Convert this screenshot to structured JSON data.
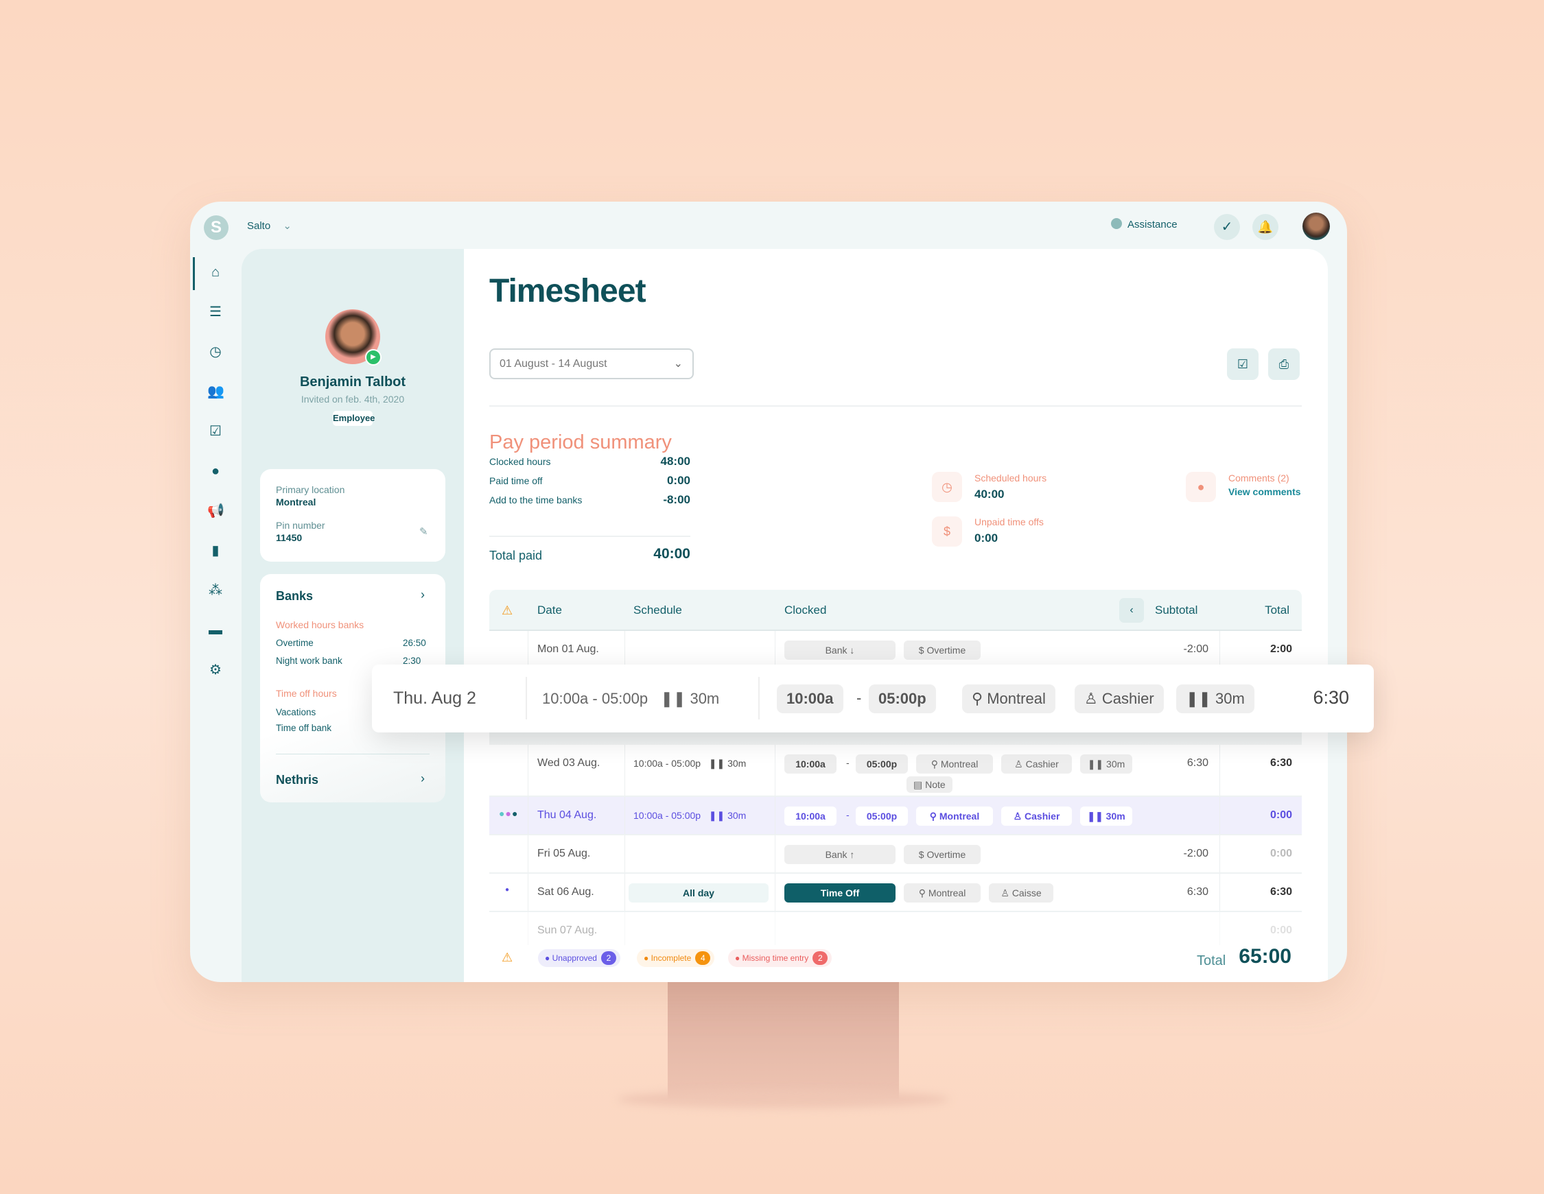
{
  "colors": {
    "brand": "#14606a",
    "accent": "#f0917a",
    "highlight": "#5b4ee0",
    "background": "#fcd8c2"
  },
  "topbar": {
    "logo_letter": "S",
    "org": "Salto",
    "assistance": "Assistance"
  },
  "rail": [
    {
      "icon": "home-icon",
      "glyph": "⌂"
    },
    {
      "icon": "list-icon",
      "glyph": "☰"
    },
    {
      "icon": "clock-icon",
      "glyph": "◷"
    },
    {
      "icon": "users-icon",
      "glyph": "👥"
    },
    {
      "icon": "tasks-icon",
      "glyph": "☑"
    },
    {
      "icon": "chat-icon",
      "glyph": "●"
    },
    {
      "icon": "megaphone-icon",
      "glyph": "📢"
    },
    {
      "icon": "chart-icon",
      "glyph": "▮"
    },
    {
      "icon": "org-icon",
      "glyph": "⁂"
    },
    {
      "icon": "card-icon",
      "glyph": "▬"
    },
    {
      "icon": "settings-icon",
      "glyph": "⚙"
    }
  ],
  "profile": {
    "name": "Benjamin Talbot",
    "invited": "Invited on feb. 4th, 2020",
    "role": "Employee",
    "location_label": "Primary location",
    "location": "Montreal",
    "pin_label": "Pin number",
    "pin": "11450"
  },
  "banks": {
    "title": "Banks",
    "worked_title": "Worked hours banks",
    "worked": [
      {
        "label": "Overtime",
        "value": "26:50"
      },
      {
        "label": "Night work bank",
        "value": "2:30"
      }
    ],
    "timeoff_title": "Time off hours",
    "timeoff": [
      {
        "label": "Vacations"
      },
      {
        "label": "Time off bank"
      }
    ],
    "nethris": "Nethris"
  },
  "main": {
    "title": "Timesheet",
    "period": "01 August - 14 August"
  },
  "summary": {
    "title": "Pay period summary",
    "rows": [
      {
        "label": "Clocked hours",
        "value": "48:00"
      },
      {
        "label": "Paid time off",
        "value": "0:00"
      },
      {
        "label": "Add to the time banks",
        "value": "-8:00"
      }
    ],
    "total_label": "Total paid",
    "total": "40:00",
    "scheduled_label": "Scheduled hours",
    "scheduled": "40:00",
    "unpaid_label": "Unpaid time offs",
    "unpaid": "0:00",
    "comments_label": "Comments (2)",
    "comments_link": "View comments"
  },
  "table": {
    "headers": {
      "date": "Date",
      "schedule": "Schedule",
      "clocked": "Clocked",
      "subtotal": "Subtotal",
      "total": "Total"
    },
    "rows": [
      {
        "date": "Mon 01 Aug.",
        "schedule": "",
        "chips": [
          "Bank ↓",
          "$ Overtime"
        ],
        "subtotal": "-2:00",
        "total": "2:00"
      },
      {
        "date": "Wed 03 Aug.",
        "schedule": "10:00a - 05:00p   ❚❚ 30m",
        "chips": [
          "10:00a",
          "-",
          "05:00p",
          "⚲ Montreal",
          "♙ Cashier",
          "❚❚ 30m"
        ],
        "extra": "▤ Note",
        "subtotal": "6:30",
        "total": "6:30"
      },
      {
        "date": "Thu 04 Aug.",
        "schedule": "10:00a - 05:00p   ❚❚ 30m",
        "chips": [
          "10:00a",
          "-",
          "05:00p",
          "⚲ Montreal",
          "♙ Cashier",
          "❚❚ 30m"
        ],
        "subtotal": "",
        "total": "0:00",
        "highlight": true
      },
      {
        "date": "Fri 05 Aug.",
        "schedule": "",
        "chips": [
          "Bank ↑",
          "$ Overtime"
        ],
        "subtotal": "-2:00",
        "total": "0:00"
      },
      {
        "date": "Sat 06 Aug.",
        "schedule": "All day",
        "chips": [
          "Time Off",
          "⚲ Montreal",
          "♙ Caisse"
        ],
        "subtotal": "6:30",
        "total": "6:30"
      },
      {
        "date": "Sun 07 Aug.",
        "schedule": "",
        "chips": [],
        "subtotal": "",
        "total": "0:00"
      }
    ],
    "footer": {
      "unapproved": "Unapproved",
      "unapproved_n": "2",
      "incomplete": "Incomplete",
      "incomplete_n": "4",
      "missing": "Missing time entry",
      "missing_n": "2",
      "total_label": "Total",
      "total": "65:00"
    }
  },
  "float_row": {
    "date": "Thu. Aug 2",
    "schedule": "10:00a - 05:00p",
    "break": "❚❚ 30m",
    "start": "10:00a",
    "sep": "-",
    "end": "05:00p",
    "location": "Montreal",
    "position": "Cashier",
    "clock_break": "❚❚ 30m",
    "total": "6:30"
  }
}
